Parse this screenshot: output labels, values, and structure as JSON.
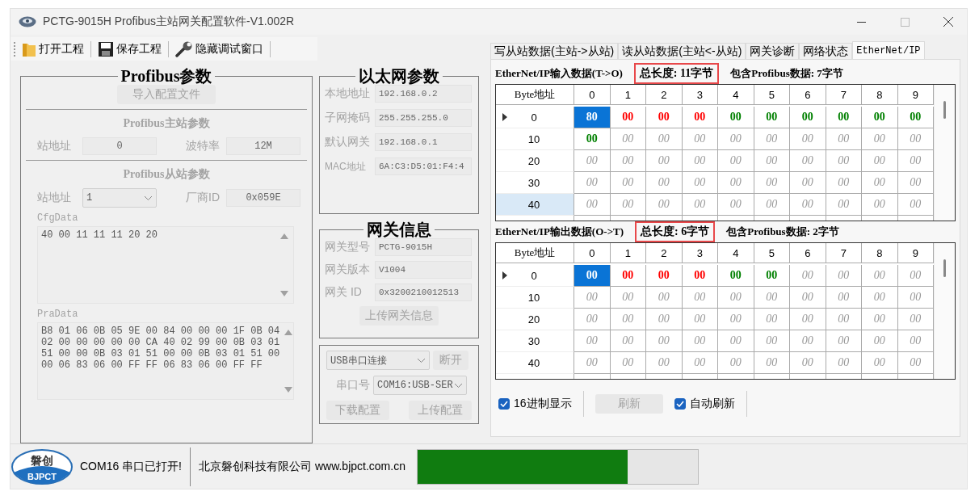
{
  "window": {
    "title": "PCTG-9015H  Profibus主站网关配置软件-V1.002R"
  },
  "toolbar": [
    {
      "label": "打开工程"
    },
    {
      "label": "保存工程"
    },
    {
      "label": "隐藏调试窗口"
    }
  ],
  "profibus": {
    "title": "Profibus参数",
    "import_button": "导入配置文件",
    "master": {
      "heading": "Profibus主站参数",
      "station_label": "站地址",
      "station_value": "0",
      "baud_label": "波特率",
      "baud_value": "12M"
    },
    "slave": {
      "heading": "Profibus从站参数",
      "station_label": "站地址",
      "station_value": "1",
      "vendor_label": "厂商ID",
      "vendor_value": "0x059E"
    },
    "cfg": {
      "label": "CfgData",
      "lines": [
        "40 00 11 11 11 20 20"
      ]
    },
    "pra": {
      "label": "PraData",
      "lines": [
        "B8 01 06 0B 05 9E 00 84 00 00 00 1F 0B 04",
        "02 00 00 00 00 00 CA 40 02 99 00 0B 03 01",
        "51 00 00 0B 03 01 51 00 00 0B 03 01 51 00",
        "00 06 83 06 00 FF FF 06 83 06 00 FF FF"
      ]
    }
  },
  "ethernet": {
    "title": "以太网参数",
    "fields": [
      {
        "label": "本地地址",
        "value": "192.168.0.2"
      },
      {
        "label": "子网掩码",
        "value": "255.255.255.0"
      },
      {
        "label": "默认网关",
        "value": "192.168.0.1"
      },
      {
        "label": "MAC地址",
        "value": "6A:C3:D5:01:F4:4"
      }
    ]
  },
  "gateway": {
    "title": "网关信息",
    "fields": [
      {
        "label": "网关型号",
        "value": "PCTG-9015H"
      },
      {
        "label": "网关版本",
        "value": "V1004"
      },
      {
        "label": "网关 ID",
        "value": "0x3200210012513"
      }
    ],
    "upload_button": "上传网关信息"
  },
  "connection": {
    "mode": "USB串口连接",
    "disconnect_button": "断开",
    "port_label": "串口号",
    "port": "COM16:USB-SER",
    "download_button": "下载配置",
    "upload_button": "上传配置"
  },
  "tabs": [
    {
      "label": "写从站数据(主站->从站)",
      "selected": false
    },
    {
      "label": "读从站数据(主站<-从站)",
      "selected": false
    },
    {
      "label": "网关诊断",
      "selected": false
    },
    {
      "label": "网络状态",
      "selected": false
    },
    {
      "label": "EtherNet/IP",
      "selected": true
    }
  ],
  "grids": [
    {
      "caption": "EtherNet/IP输入数据(T->O)",
      "total": "总长度: 11字节",
      "total_highlighted": true,
      "profibus": "包含Profibus数据: 7字节",
      "corner": "Byte地址",
      "columns": [
        "0",
        "1",
        "2",
        "3",
        "4",
        "5",
        "6",
        "7",
        "8",
        "9"
      ],
      "rows": [
        {
          "address": "0",
          "current": true,
          "selected": false,
          "cells": [
            {
              "text": "80",
              "kind": "selected"
            },
            {
              "text": "00",
              "kind": "red"
            },
            {
              "text": "00",
              "kind": "red"
            },
            {
              "text": "00",
              "kind": "red"
            },
            {
              "text": "00",
              "kind": "green"
            },
            {
              "text": "00",
              "kind": "green"
            },
            {
              "text": "00",
              "kind": "green"
            },
            {
              "text": "00",
              "kind": "green"
            },
            {
              "text": "00",
              "kind": "green"
            },
            {
              "text": "00",
              "kind": "green"
            }
          ]
        },
        {
          "address": "10",
          "current": false,
          "selected": false,
          "cells": [
            {
              "text": "00",
              "kind": "green"
            },
            {
              "text": "00",
              "kind": "empty"
            },
            {
              "text": "00",
              "kind": "empty"
            },
            {
              "text": "00",
              "kind": "empty"
            },
            {
              "text": "00",
              "kind": "empty"
            },
            {
              "text": "00",
              "kind": "empty"
            },
            {
              "text": "00",
              "kind": "empty"
            },
            {
              "text": "00",
              "kind": "empty"
            },
            {
              "text": "00",
              "kind": "empty"
            },
            {
              "text": "00",
              "kind": "empty"
            }
          ]
        },
        {
          "address": "20",
          "current": false,
          "selected": false,
          "cells": [
            {
              "text": "00",
              "kind": "empty"
            },
            {
              "text": "00",
              "kind": "empty"
            },
            {
              "text": "00",
              "kind": "empty"
            },
            {
              "text": "00",
              "kind": "empty"
            },
            {
              "text": "00",
              "kind": "empty"
            },
            {
              "text": "00",
              "kind": "empty"
            },
            {
              "text": "00",
              "kind": "empty"
            },
            {
              "text": "00",
              "kind": "empty"
            },
            {
              "text": "00",
              "kind": "empty"
            },
            {
              "text": "00",
              "kind": "empty"
            }
          ]
        },
        {
          "address": "30",
          "current": false,
          "selected": false,
          "cells": [
            {
              "text": "00",
              "kind": "empty"
            },
            {
              "text": "00",
              "kind": "empty"
            },
            {
              "text": "00",
              "kind": "empty"
            },
            {
              "text": "00",
              "kind": "empty"
            },
            {
              "text": "00",
              "kind": "empty"
            },
            {
              "text": "00",
              "kind": "empty"
            },
            {
              "text": "00",
              "kind": "empty"
            },
            {
              "text": "00",
              "kind": "empty"
            },
            {
              "text": "00",
              "kind": "empty"
            },
            {
              "text": "00",
              "kind": "empty"
            }
          ]
        },
        {
          "address": "40",
          "current": false,
          "selected": true,
          "cells": [
            {
              "text": "00",
              "kind": "empty"
            },
            {
              "text": "00",
              "kind": "empty"
            },
            {
              "text": "00",
              "kind": "empty"
            },
            {
              "text": "00",
              "kind": "empty"
            },
            {
              "text": "00",
              "kind": "empty"
            },
            {
              "text": "00",
              "kind": "empty"
            },
            {
              "text": "00",
              "kind": "empty"
            },
            {
              "text": "00",
              "kind": "empty"
            },
            {
              "text": "00",
              "kind": "empty"
            },
            {
              "text": "00",
              "kind": "empty"
            }
          ]
        }
      ]
    },
    {
      "caption": "EtherNet/IP输出数据(O->T)",
      "total": "总长度: 6字节",
      "total_highlighted": true,
      "profibus": "包含Profibus数据: 2字节",
      "corner": "Byte地址",
      "columns": [
        "0",
        "1",
        "2",
        "3",
        "4",
        "5",
        "6",
        "7",
        "8",
        "9"
      ],
      "rows": [
        {
          "address": "0",
          "current": true,
          "selected": false,
          "cells": [
            {
              "text": "00",
              "kind": "selected"
            },
            {
              "text": "00",
              "kind": "red"
            },
            {
              "text": "00",
              "kind": "red"
            },
            {
              "text": "00",
              "kind": "red"
            },
            {
              "text": "00",
              "kind": "green"
            },
            {
              "text": "00",
              "kind": "green"
            },
            {
              "text": "00",
              "kind": "empty"
            },
            {
              "text": "00",
              "kind": "empty"
            },
            {
              "text": "00",
              "kind": "empty"
            },
            {
              "text": "00",
              "kind": "empty"
            }
          ]
        },
        {
          "address": "10",
          "current": false,
          "selected": false,
          "cells": [
            {
              "text": "00",
              "kind": "empty"
            },
            {
              "text": "00",
              "kind": "empty"
            },
            {
              "text": "00",
              "kind": "empty"
            },
            {
              "text": "00",
              "kind": "empty"
            },
            {
              "text": "00",
              "kind": "empty"
            },
            {
              "text": "00",
              "kind": "empty"
            },
            {
              "text": "00",
              "kind": "empty"
            },
            {
              "text": "00",
              "kind": "empty"
            },
            {
              "text": "00",
              "kind": "empty"
            },
            {
              "text": "00",
              "kind": "empty"
            }
          ]
        },
        {
          "address": "20",
          "current": false,
          "selected": false,
          "cells": [
            {
              "text": "00",
              "kind": "empty"
            },
            {
              "text": "00",
              "kind": "empty"
            },
            {
              "text": "00",
              "kind": "empty"
            },
            {
              "text": "00",
              "kind": "empty"
            },
            {
              "text": "00",
              "kind": "empty"
            },
            {
              "text": "00",
              "kind": "empty"
            },
            {
              "text": "00",
              "kind": "empty"
            },
            {
              "text": "00",
              "kind": "empty"
            },
            {
              "text": "00",
              "kind": "empty"
            },
            {
              "text": "00",
              "kind": "empty"
            }
          ]
        },
        {
          "address": "30",
          "current": false,
          "selected": false,
          "cells": [
            {
              "text": "00",
              "kind": "empty"
            },
            {
              "text": "00",
              "kind": "empty"
            },
            {
              "text": "00",
              "kind": "empty"
            },
            {
              "text": "00",
              "kind": "empty"
            },
            {
              "text": "00",
              "kind": "empty"
            },
            {
              "text": "00",
              "kind": "empty"
            },
            {
              "text": "00",
              "kind": "empty"
            },
            {
              "text": "00",
              "kind": "empty"
            },
            {
              "text": "00",
              "kind": "empty"
            },
            {
              "text": "00",
              "kind": "empty"
            }
          ]
        },
        {
          "address": "40",
          "current": false,
          "selected": false,
          "cells": [
            {
              "text": "00",
              "kind": "empty"
            },
            {
              "text": "00",
              "kind": "empty"
            },
            {
              "text": "00",
              "kind": "empty"
            },
            {
              "text": "00",
              "kind": "empty"
            },
            {
              "text": "00",
              "kind": "empty"
            },
            {
              "text": "00",
              "kind": "empty"
            },
            {
              "text": "00",
              "kind": "empty"
            },
            {
              "text": "00",
              "kind": "empty"
            },
            {
              "text": "00",
              "kind": "empty"
            },
            {
              "text": "00",
              "kind": "empty"
            }
          ]
        }
      ]
    }
  ],
  "options": {
    "hex": {
      "label": "16进制显示",
      "checked": true
    },
    "refresh_button": "刷新",
    "auto_refresh": {
      "label": "自动刷新",
      "checked": true
    }
  },
  "status_bar": {
    "logo_top": "磐创",
    "logo_bottom": "BJPCT",
    "message": "COM16 串口已打开!",
    "company": "北京磐创科技有限公司 www.bjpct.com.cn",
    "progress": {
      "level": 0.75
    }
  }
}
